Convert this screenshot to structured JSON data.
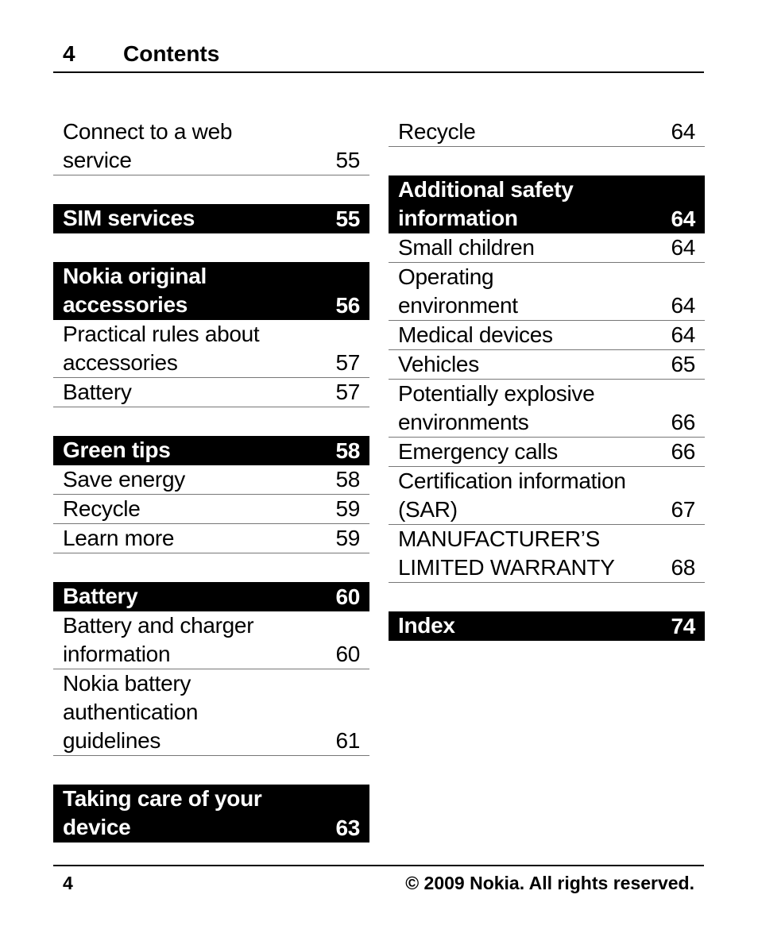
{
  "header": {
    "page_number": "4",
    "title": "Contents"
  },
  "footer": {
    "page_number": "4",
    "copyright": "© 2009 Nokia. All rights reserved."
  },
  "columns": [
    {
      "items": [
        {
          "type": "entry",
          "lines": [
            "Connect to a web",
            "service"
          ],
          "page": "55"
        },
        {
          "type": "gap"
        },
        {
          "type": "section",
          "lines": [
            "SIM services"
          ],
          "page": "55"
        },
        {
          "type": "gap"
        },
        {
          "type": "section",
          "lines": [
            "Nokia original",
            "accessories"
          ],
          "page": "56"
        },
        {
          "type": "entry",
          "lines": [
            "Practical rules about",
            "accessories"
          ],
          "page": "57"
        },
        {
          "type": "entry",
          "lines": [
            "Battery"
          ],
          "page": "57"
        },
        {
          "type": "gap"
        },
        {
          "type": "section",
          "lines": [
            "Green tips"
          ],
          "page": "58"
        },
        {
          "type": "entry",
          "lines": [
            "Save energy"
          ],
          "page": "58"
        },
        {
          "type": "entry",
          "lines": [
            "Recycle"
          ],
          "page": "59"
        },
        {
          "type": "entry",
          "lines": [
            "Learn more"
          ],
          "page": "59"
        },
        {
          "type": "gap"
        },
        {
          "type": "section",
          "lines": [
            "Battery"
          ],
          "page": "60"
        },
        {
          "type": "entry",
          "lines": [
            "Battery and charger",
            "information"
          ],
          "page": "60"
        },
        {
          "type": "entry",
          "lines": [
            "Nokia battery",
            "authentication",
            "guidelines"
          ],
          "page": "61"
        },
        {
          "type": "gap"
        },
        {
          "type": "section",
          "lines": [
            "Taking care of your",
            "device"
          ],
          "page": "63"
        }
      ]
    },
    {
      "items": [
        {
          "type": "entry",
          "lines": [
            "Recycle"
          ],
          "page": "64"
        },
        {
          "type": "gap"
        },
        {
          "type": "section",
          "lines": [
            "Additional safety",
            "information"
          ],
          "page": "64"
        },
        {
          "type": "entry",
          "lines": [
            "Small children"
          ],
          "page": "64"
        },
        {
          "type": "entry",
          "lines": [
            "Operating",
            "environment"
          ],
          "page": "64"
        },
        {
          "type": "entry",
          "lines": [
            "Medical devices"
          ],
          "page": "64"
        },
        {
          "type": "entry",
          "lines": [
            "Vehicles"
          ],
          "page": "65"
        },
        {
          "type": "entry",
          "lines": [
            "Potentially explosive",
            "environments"
          ],
          "page": "66"
        },
        {
          "type": "entry",
          "lines": [
            "Emergency calls"
          ],
          "page": "66"
        },
        {
          "type": "entry",
          "lines": [
            "Certification information",
            "(SAR)"
          ],
          "page": "67"
        },
        {
          "type": "entry",
          "lines": [
            "MANUFACTURER’S",
            "LIMITED WARRANTY"
          ],
          "page": "68"
        },
        {
          "type": "gap"
        },
        {
          "type": "section",
          "lines": [
            "Index"
          ],
          "page": "74"
        }
      ]
    }
  ]
}
